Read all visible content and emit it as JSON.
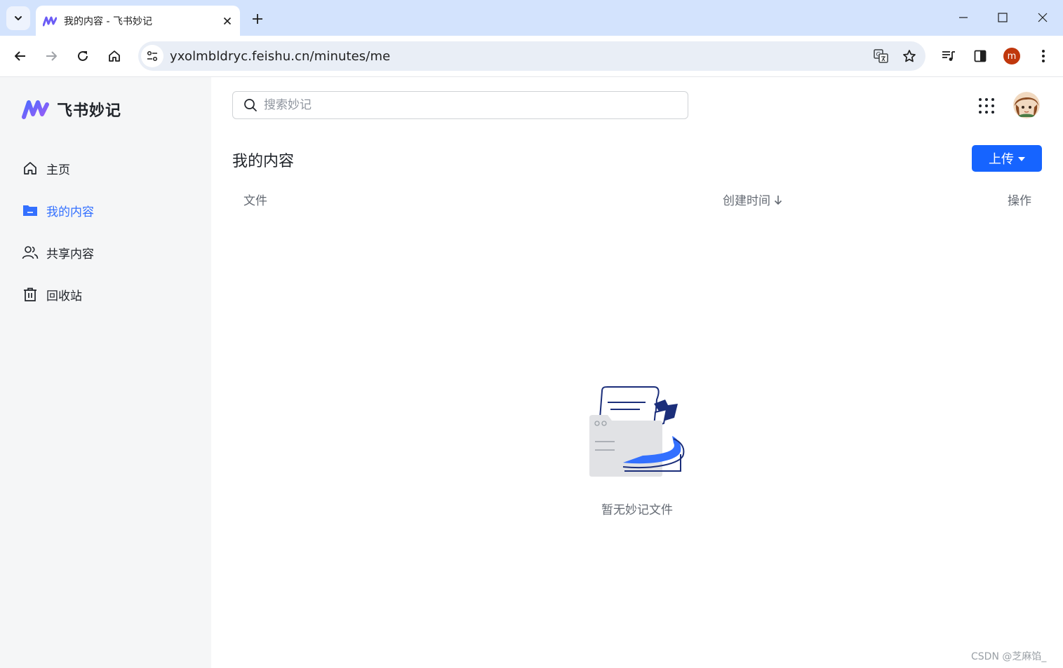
{
  "browser": {
    "tab_title": "我的内容 - 飞书妙记",
    "url": "yxolmbldryc.feishu.cn/minutes/me",
    "profile_initial": "m"
  },
  "app": {
    "logo_text": "飞书妙记",
    "search_placeholder": "搜索妙记",
    "nav": [
      {
        "label": "主页",
        "icon": "home-icon",
        "active": false
      },
      {
        "label": "我的内容",
        "icon": "folder-icon",
        "active": true
      },
      {
        "label": "共享内容",
        "icon": "users-icon",
        "active": false
      },
      {
        "label": "回收站",
        "icon": "trash-icon",
        "active": false
      }
    ],
    "page_title": "我的内容",
    "upload_label": "上传",
    "columns": {
      "file": "文件",
      "created": "创建时间",
      "actions": "操作"
    },
    "empty_text": "暂无妙记文件"
  },
  "watermark": "CSDN @芝麻馅_",
  "colors": {
    "accent": "#1664ff",
    "active_nav": "#3370ff",
    "sidebar_bg": "#f5f6f7",
    "tabbar_bg": "#d3e3fd"
  }
}
